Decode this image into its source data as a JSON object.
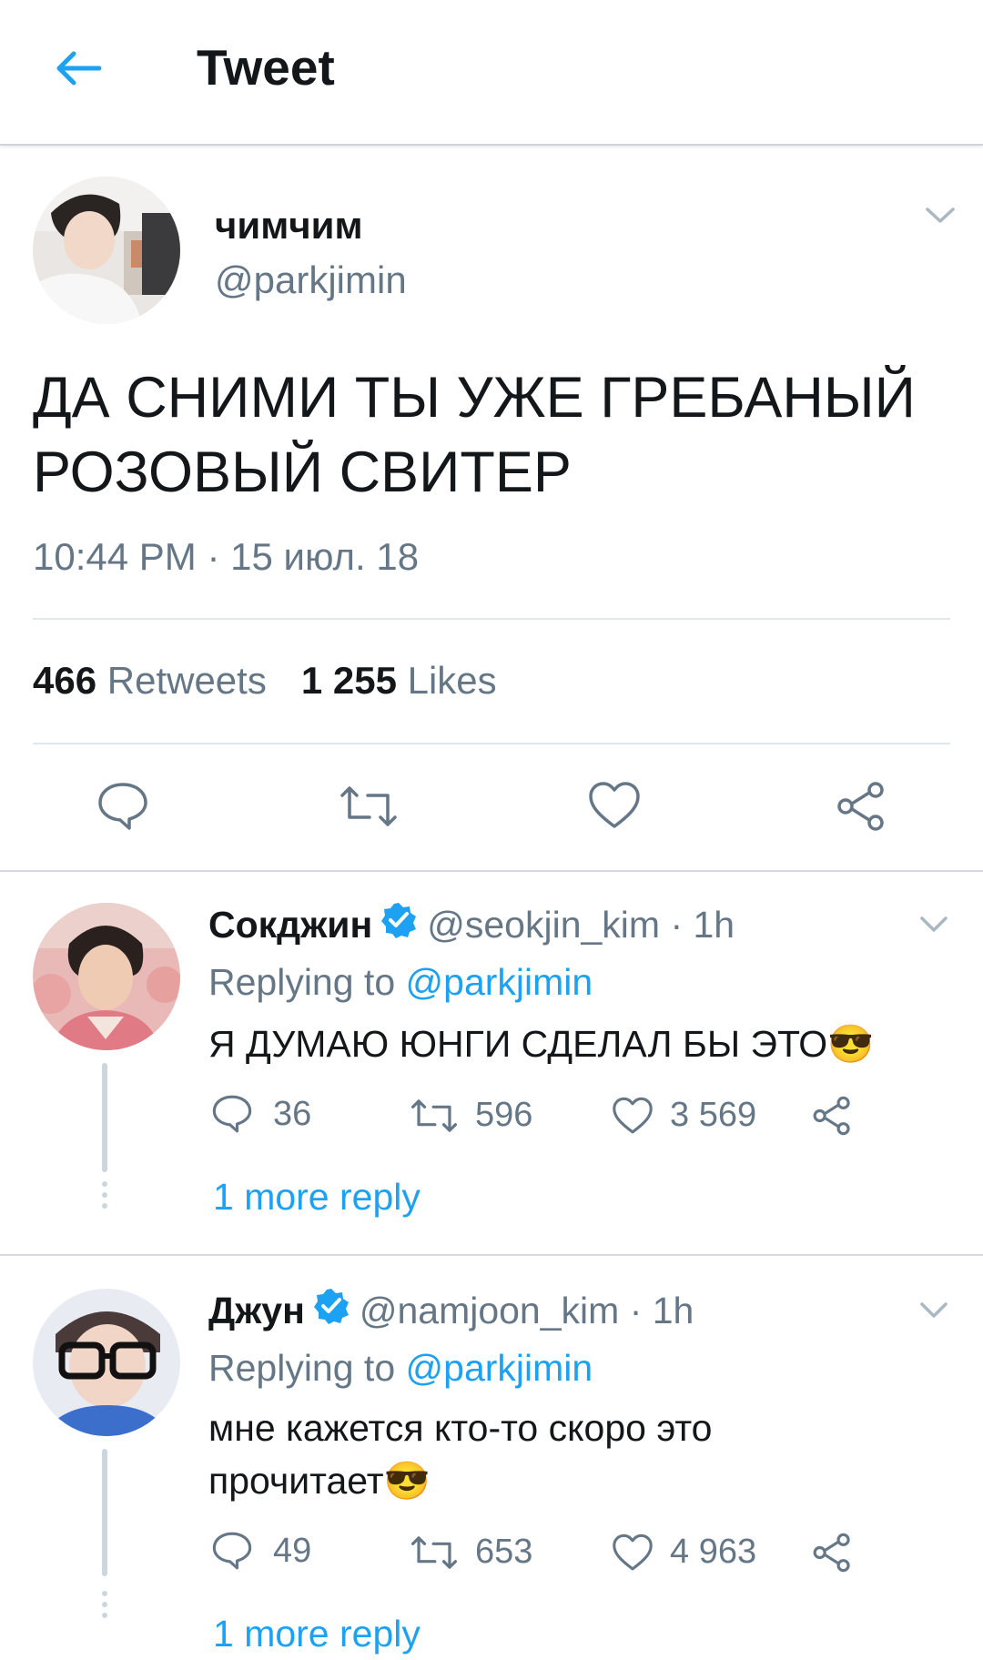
{
  "header": {
    "title": "Tweet",
    "back_icon": "arrow-left-icon",
    "accent": "#1da1f2"
  },
  "tweet": {
    "display_name": "чимчим",
    "handle": "@parkjimin",
    "text": "ДА СНИМИ ТЫ УЖЕ ГРЕБАНЫЙ РОЗОВЫЙ СВИТЕР",
    "timestamp": "10:44 PM · 15 июл. 18",
    "retweets_count": "466",
    "retweets_label": "Retweets",
    "likes_count": "1 255",
    "likes_label": "Likes"
  },
  "replies": [
    {
      "display_name": "Сокджин",
      "verified": true,
      "handle_time": "@seokjin_kim · 1h",
      "replying_prefix": "Replying to ",
      "replying_to": "@parkjimin",
      "text": "Я ДУМАЮ ЮНГИ СДЕЛАЛ БЫ ЭТО😎",
      "reply_count": "36",
      "retweet_count": "596",
      "like_count": "3 569",
      "more_reply": "1 more reply"
    },
    {
      "display_name": "Джун",
      "verified": true,
      "handle_time": "@namjoon_kim · 1h",
      "replying_prefix": "Replying to ",
      "replying_to": "@parkjimin",
      "text": "мне кажется кто-то скоро это прочитает😎",
      "reply_count": "49",
      "retweet_count": "653",
      "like_count": "4 963",
      "more_reply": "1 more reply"
    }
  ]
}
